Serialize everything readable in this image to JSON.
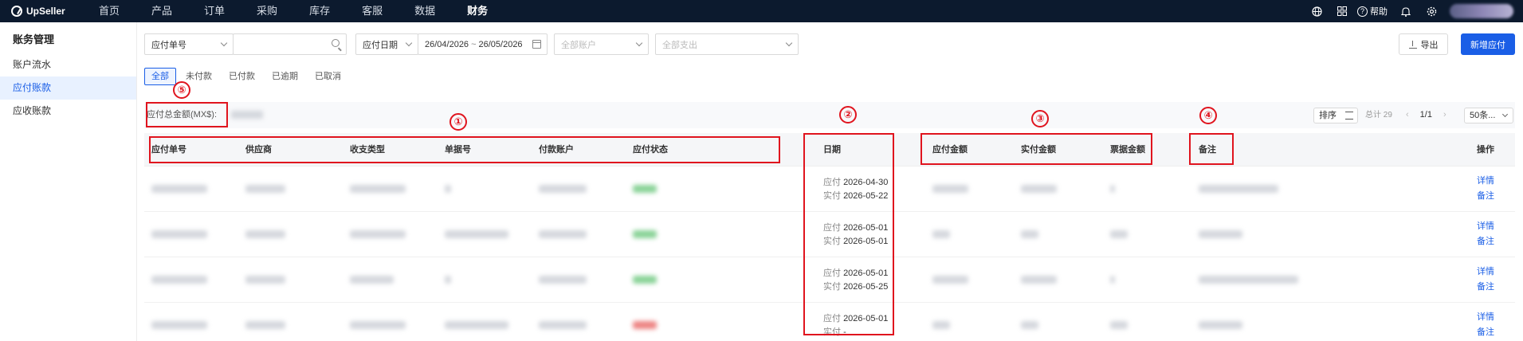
{
  "app": {
    "logo_text": "UpSeller",
    "nav": [
      {
        "label": "首页"
      },
      {
        "label": "产品"
      },
      {
        "label": "订单"
      },
      {
        "label": "采购"
      },
      {
        "label": "库存"
      },
      {
        "label": "客服"
      },
      {
        "label": "数据"
      },
      {
        "label": "财务"
      }
    ],
    "help_label": "帮助"
  },
  "sidebar": {
    "title": "账务管理",
    "items": [
      {
        "label": "账户流水"
      },
      {
        "label": "应付账款"
      },
      {
        "label": "应收账款"
      }
    ]
  },
  "filters": {
    "search_type": "应付单号",
    "search_placeholder": "",
    "date_type": "应付日期",
    "date_start": "26/04/2026",
    "date_sep": "~",
    "date_end": "26/05/2026",
    "account_placeholder": "全部账户",
    "expense_placeholder": "全部支出"
  },
  "actions": {
    "export_label": "导出",
    "new_label": "新增应付"
  },
  "tabs": [
    {
      "label": "全部"
    },
    {
      "label": "未付款"
    },
    {
      "label": "已付款"
    },
    {
      "label": "已逾期"
    },
    {
      "label": "已取消"
    }
  ],
  "summary": {
    "total_amount_label": "应付总金额(MX$):",
    "sort_label": "排序",
    "total_count": "总计 29",
    "page": "1/1",
    "prev": "‹",
    "next": "›",
    "page_size": "50条..."
  },
  "table": {
    "headers": {
      "payable_no": "应付单号",
      "supplier": "供应商",
      "type": "收支类型",
      "doc_no": "单据号",
      "account": "付款账户",
      "status": "应付状态",
      "date": "日期",
      "payable_amount": "应付金额",
      "paid_amount": "实付金额",
      "bill_amount": "票据金额",
      "remark": "备注",
      "ops": "操作"
    },
    "rows": [
      {
        "due_label": "应付",
        "due_date": "2026-04-30",
        "paid_label": "实付",
        "paid_date": "2026-05-22",
        "op_detail": "详情",
        "op_remark": "备注"
      },
      {
        "due_label": "应付",
        "due_date": "2026-05-01",
        "paid_label": "实付",
        "paid_date": "2026-05-01",
        "op_detail": "详情",
        "op_remark": "备注"
      },
      {
        "due_label": "应付",
        "due_date": "2026-05-01",
        "paid_label": "实付",
        "paid_date": "2026-05-25",
        "op_detail": "详情",
        "op_remark": "备注"
      },
      {
        "due_label": "应付",
        "due_date": "2026-05-01",
        "paid_label": "实付",
        "paid_date": "-",
        "op_detail": "详情",
        "op_remark": "备注"
      }
    ]
  },
  "annotations": [
    {
      "num": "①"
    },
    {
      "num": "②"
    },
    {
      "num": "③"
    },
    {
      "num": "④"
    },
    {
      "num": "⑤"
    }
  ],
  "colors": {
    "nav_bg": "#0c1a2e",
    "primary": "#1a5ee6",
    "annotation": "#e0141e",
    "status_paid": "#58c06c",
    "status_overdue": "#e6504f"
  }
}
